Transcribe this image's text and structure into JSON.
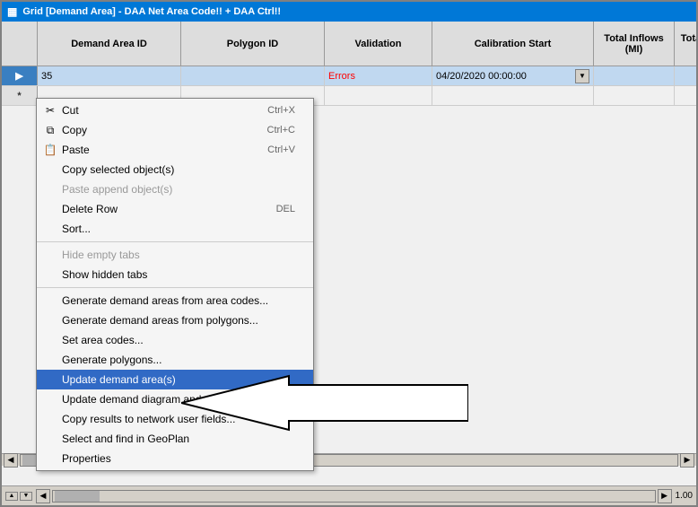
{
  "window": {
    "title": "Grid [Demand Area] - DAA Net Area Code!! + DAA Ctrl!!"
  },
  "grid": {
    "columns": [
      {
        "id": "row-num",
        "label": ""
      },
      {
        "id": "demand-area-id",
        "label": "Demand Area ID"
      },
      {
        "id": "polygon-id",
        "label": "Polygon ID"
      },
      {
        "id": "validation",
        "label": "Validation"
      },
      {
        "id": "calibration-start",
        "label": "Calibration Start"
      },
      {
        "id": "total-inflows",
        "label": "Total Inflows (MI)"
      },
      {
        "id": "total-outflows",
        "label": "Total Outflows (MI)"
      }
    ],
    "rows": [
      {
        "indicator": "▶",
        "demand_area_id": "35",
        "polygon_id": "",
        "validation": "Errors",
        "calibration_start": "04/20/2020 00:00:00",
        "total_inflows": "",
        "total_outflows": "",
        "selected": true
      },
      {
        "indicator": "*",
        "demand_area_id": "",
        "polygon_id": "",
        "validation": "",
        "calibration_start": "",
        "total_inflows": "",
        "total_outflows": "",
        "selected": false
      }
    ]
  },
  "context_menu": {
    "items": [
      {
        "id": "cut",
        "label": "Cut",
        "shortcut": "Ctrl+X",
        "disabled": false,
        "separator_after": false
      },
      {
        "id": "copy",
        "label": "Copy",
        "shortcut": "Ctrl+C",
        "disabled": false,
        "separator_after": false
      },
      {
        "id": "paste",
        "label": "Paste",
        "shortcut": "Ctrl+V",
        "disabled": false,
        "separator_after": false
      },
      {
        "id": "copy-selected",
        "label": "Copy selected object(s)",
        "shortcut": "",
        "disabled": false,
        "separator_after": false
      },
      {
        "id": "paste-append",
        "label": "Paste append object(s)",
        "shortcut": "",
        "disabled": true,
        "separator_after": false
      },
      {
        "id": "delete-row",
        "label": "Delete Row",
        "shortcut": "DEL",
        "disabled": false,
        "separator_after": false
      },
      {
        "id": "sort",
        "label": "Sort...",
        "shortcut": "",
        "disabled": false,
        "separator_after": false
      },
      {
        "id": "hide-empty-tabs",
        "label": "Hide empty tabs",
        "shortcut": "",
        "disabled": true,
        "separator_after": false
      },
      {
        "id": "show-hidden-tabs",
        "label": "Show hidden tabs",
        "shortcut": "",
        "disabled": false,
        "separator_after": true
      },
      {
        "id": "generate-from-area-codes",
        "label": "Generate demand areas from area codes...",
        "shortcut": "",
        "disabled": false,
        "separator_after": false
      },
      {
        "id": "generate-from-polygons",
        "label": "Generate demand areas from polygons...",
        "shortcut": "",
        "disabled": false,
        "separator_after": false
      },
      {
        "id": "set-area-codes",
        "label": "Set area codes...",
        "shortcut": "",
        "disabled": false,
        "separator_after": false
      },
      {
        "id": "generate-polygons",
        "label": "Generate polygons...",
        "shortcut": "",
        "disabled": false,
        "separator_after": false
      },
      {
        "id": "update-demand-areas",
        "label": "Update demand area(s)",
        "shortcut": "",
        "disabled": false,
        "separator_after": false,
        "highlighted": true
      },
      {
        "id": "update-diagram",
        "label": "Update demand diagram and ne...",
        "shortcut": "",
        "disabled": false,
        "separator_after": false
      },
      {
        "id": "copy-results",
        "label": "Copy results to network user fields...",
        "shortcut": "",
        "disabled": false,
        "separator_after": false
      },
      {
        "id": "select-geoplan",
        "label": "Select and find in GeoPlan",
        "shortcut": "",
        "disabled": false,
        "separator_after": false
      },
      {
        "id": "properties",
        "label": "Properties",
        "shortcut": "",
        "disabled": false,
        "separator_after": false
      }
    ]
  },
  "icons": {
    "cut": "✂",
    "copy": "📋",
    "paste": "📌"
  },
  "arrow": {
    "pointing_to": "Update demand area(s)"
  }
}
